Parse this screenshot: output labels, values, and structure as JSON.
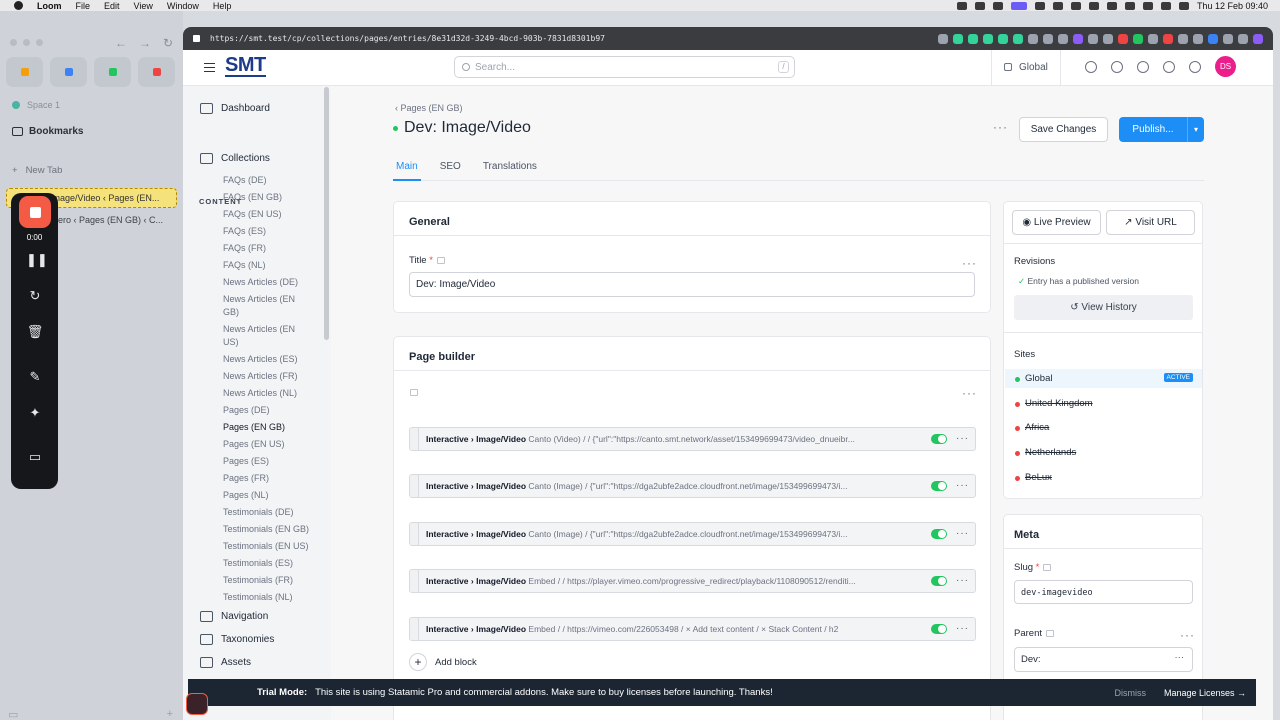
{
  "menubar": {
    "app": "Loom",
    "items": [
      "File",
      "Edit",
      "View",
      "Window",
      "Help"
    ],
    "clock": "Thu 12 Feb  09:40"
  },
  "arc": {
    "space": "Space 1",
    "bookmarks": "Bookmarks",
    "new_tab": "New Tab",
    "tabs": [
      "Dev: Image/Video ‹ Pages (EN...",
      "ero ‹ Pages (EN GB) ‹ C..."
    ],
    "pin_colors": [
      "#f59e0b",
      "#3b82f6",
      "#22c55e",
      "#ef4444"
    ]
  },
  "loom": {
    "timer": "0:00"
  },
  "browser": {
    "url": "https://smt.test/cp/collections/pages/entries/8e31d32d-3249-4bcd-903b-7831d8301b97"
  },
  "header": {
    "logo": "SMT",
    "search_placeholder": "Search...",
    "search_shortcut": "/",
    "site": "Global",
    "avatar": "DS"
  },
  "nav": {
    "dashboard": "Dashboard",
    "section": "CONTENT",
    "collections": "Collections",
    "sub_items": [
      "FAQs (DE)",
      "FAQs (EN GB)",
      "FAQs (EN US)",
      "FAQs (ES)",
      "FAQs (FR)",
      "FAQs (NL)",
      "News Articles (DE)",
      "News Articles (EN",
      "GB)",
      "News Articles (EN",
      "US)",
      "News Articles (ES)",
      "News Articles (FR)",
      "News Articles (NL)",
      "Pages (DE)",
      "Pages (EN GB)",
      "Pages (EN US)",
      "Pages (ES)",
      "Pages (FR)",
      "Pages (NL)",
      "Testimonials (DE)",
      "Testimonials (EN GB)",
      "Testimonials (EN US)",
      "Testimonials (ES)",
      "Testimonials (FR)",
      "Testimonials (NL)"
    ],
    "navigation": "Navigation",
    "taxonomies": "Taxonomies",
    "assets": "Assets"
  },
  "page": {
    "breadcrumb": "‹ Pages (EN GB)",
    "title": "Dev: Image/Video",
    "save": "Save Changes",
    "publish": "Publish...",
    "tabs": [
      "Main",
      "SEO",
      "Translations"
    ]
  },
  "general": {
    "heading": "General",
    "title_label": "Title",
    "title_value": "Dev: Image/Video"
  },
  "builder": {
    "heading": "Page builder",
    "blocks": [
      {
        "group": "Interactive",
        "type": "Image/Video",
        "preview": "Canto (Video) / / {\"url\":\"https://canto.smt.network/asset/153499699473/video_dnueibr..."
      },
      {
        "group": "Interactive",
        "type": "Image/Video",
        "preview": "Canto (Image) / {\"url\":\"https://dga2ubfe2adce.cloudfront.net/image/153499699473/i..."
      },
      {
        "group": "Interactive",
        "type": "Image/Video",
        "preview": "Canto (Image) / {\"url\":\"https://dga2ubfe2adce.cloudfront.net/image/153499699473/i..."
      },
      {
        "group": "Interactive",
        "type": "Image/Video",
        "preview": "Embed / / https://player.vimeo.com/progressive_redirect/playback/1108090512/renditi..."
      },
      {
        "group": "Interactive",
        "type": "Image/Video",
        "preview": "Embed / / https://vimeo.com/226053498 / × Add text content / × Stack Content / h2"
      }
    ],
    "sep": "›",
    "add_block": "Add block"
  },
  "sidebar": {
    "live_preview": "Live Preview",
    "visit_url": "Visit URL",
    "revisions": "Revisions",
    "revision_note": "Entry has a published version",
    "view_history": "View History",
    "sites_heading": "Sites",
    "sites": [
      {
        "name": "Global",
        "color": "#22c55e",
        "active": true,
        "strike": false
      },
      {
        "name": "United Kingdom",
        "color": "#ef4444",
        "active": false,
        "strike": true
      },
      {
        "name": "Africa",
        "color": "#ef4444",
        "active": false,
        "strike": true
      },
      {
        "name": "Netherlands",
        "color": "#ef4444",
        "active": false,
        "strike": true
      },
      {
        "name": "BeLux",
        "color": "#ef4444",
        "active": false,
        "strike": true
      }
    ],
    "active_badge": "ACTIVE",
    "meta": "Meta",
    "slug_label": "Slug",
    "slug_value": "dev-imagevideo",
    "parent_label": "Parent",
    "parent_value": "Dev:"
  },
  "trial": {
    "bold": "Trial Mode:",
    "text": "This site is using Statamic Pro and commercial addons. Make sure to buy licenses before launching. Thanks!",
    "dismiss": "Dismiss",
    "manage": "Manage Licenses →"
  }
}
